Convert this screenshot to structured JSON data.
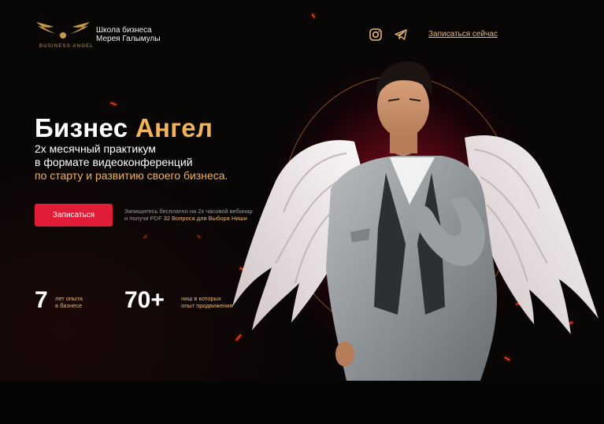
{
  "header": {
    "logo_text": "BUSINESS ANGEL",
    "school_line1": "Школа бизнеса",
    "school_line2": "Мерея Галымулы",
    "signup_link": "Записаться сейчас",
    "social_icons": [
      "instagram-icon",
      "telegram-icon"
    ]
  },
  "hero": {
    "title_part1": "Бизнес",
    "title_part2": "Ангел",
    "subtitle_line1": "2х месячный практикум",
    "subtitle_line2": "в формате видеоконференций",
    "subtitle_line3": "по старту и развитию своего бизнеса.",
    "cta_label": "Записаться",
    "note_line1": "Запишитесь бесплатно на 2х часовой вебинар",
    "note_line2_prefix": "и получи PDF",
    "note_line2_highlight": "32 Вопроса для Выбора Ниши"
  },
  "stats": [
    {
      "value": "7",
      "label_line1": "лет опыта",
      "label_line2": "в бизнесе"
    },
    {
      "value": "70+",
      "label_line1": "ниш в которых",
      "label_line2": "опыт продвижения"
    }
  ],
  "colors": {
    "accent": "#f2b25a",
    "button": "#e01c36",
    "link": "#e8b873"
  }
}
